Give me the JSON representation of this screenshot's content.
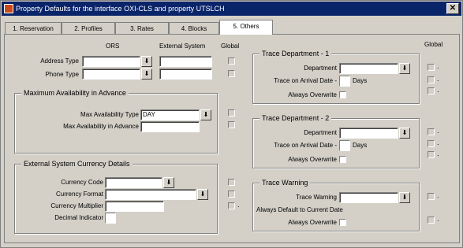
{
  "window": {
    "title": "Property Defaults for the interface OXI-CLS and property UTSLCH",
    "close_glyph": "✕"
  },
  "tabs": [
    {
      "label": "1. Reservation"
    },
    {
      "label": "2. Profiles"
    },
    {
      "label": "3. Rates"
    },
    {
      "label": "4. Blocks"
    },
    {
      "label": "5. Others",
      "active": true
    }
  ],
  "columns": {
    "ors": "ORS",
    "external_system": "External System",
    "global": "Global"
  },
  "fields": {
    "address_type": {
      "label": "Address Type",
      "value": ""
    },
    "phone_type": {
      "label": "Phone Type",
      "value": ""
    }
  },
  "max_availability": {
    "title": "Maximum Availability in Advance",
    "type_label": "Max Availability Type",
    "type_value": "DAY",
    "advance_label": "Max Availability in Advance",
    "advance_value": ""
  },
  "currency": {
    "title": "External System Currency Details",
    "code_label": "Currency Code",
    "format_label": "Currency Format",
    "multiplier_label": "Currency Multiplier",
    "decimal_label": "Decimal Indicator"
  },
  "right_global_label": "Global",
  "trace1": {
    "title": "Trace Department - 1",
    "department_label": "Department",
    "arrival_label": "Trace on Arrival Date -",
    "days_label": "Days",
    "overwrite_label": "Always Overwrite"
  },
  "trace2": {
    "title": "Trace Department - 2",
    "department_label": "Department",
    "arrival_label": "Trace on Arrival Date -",
    "days_label": "Days",
    "overwrite_label": "Always Overwrite"
  },
  "warning": {
    "title": "Trace Warning",
    "warning_label": "Trace Warning",
    "default_label": "Always Default to Current Date",
    "overwrite_label": "Always Overwrite"
  },
  "dropdown_glyph": "⬇",
  "dot": "."
}
